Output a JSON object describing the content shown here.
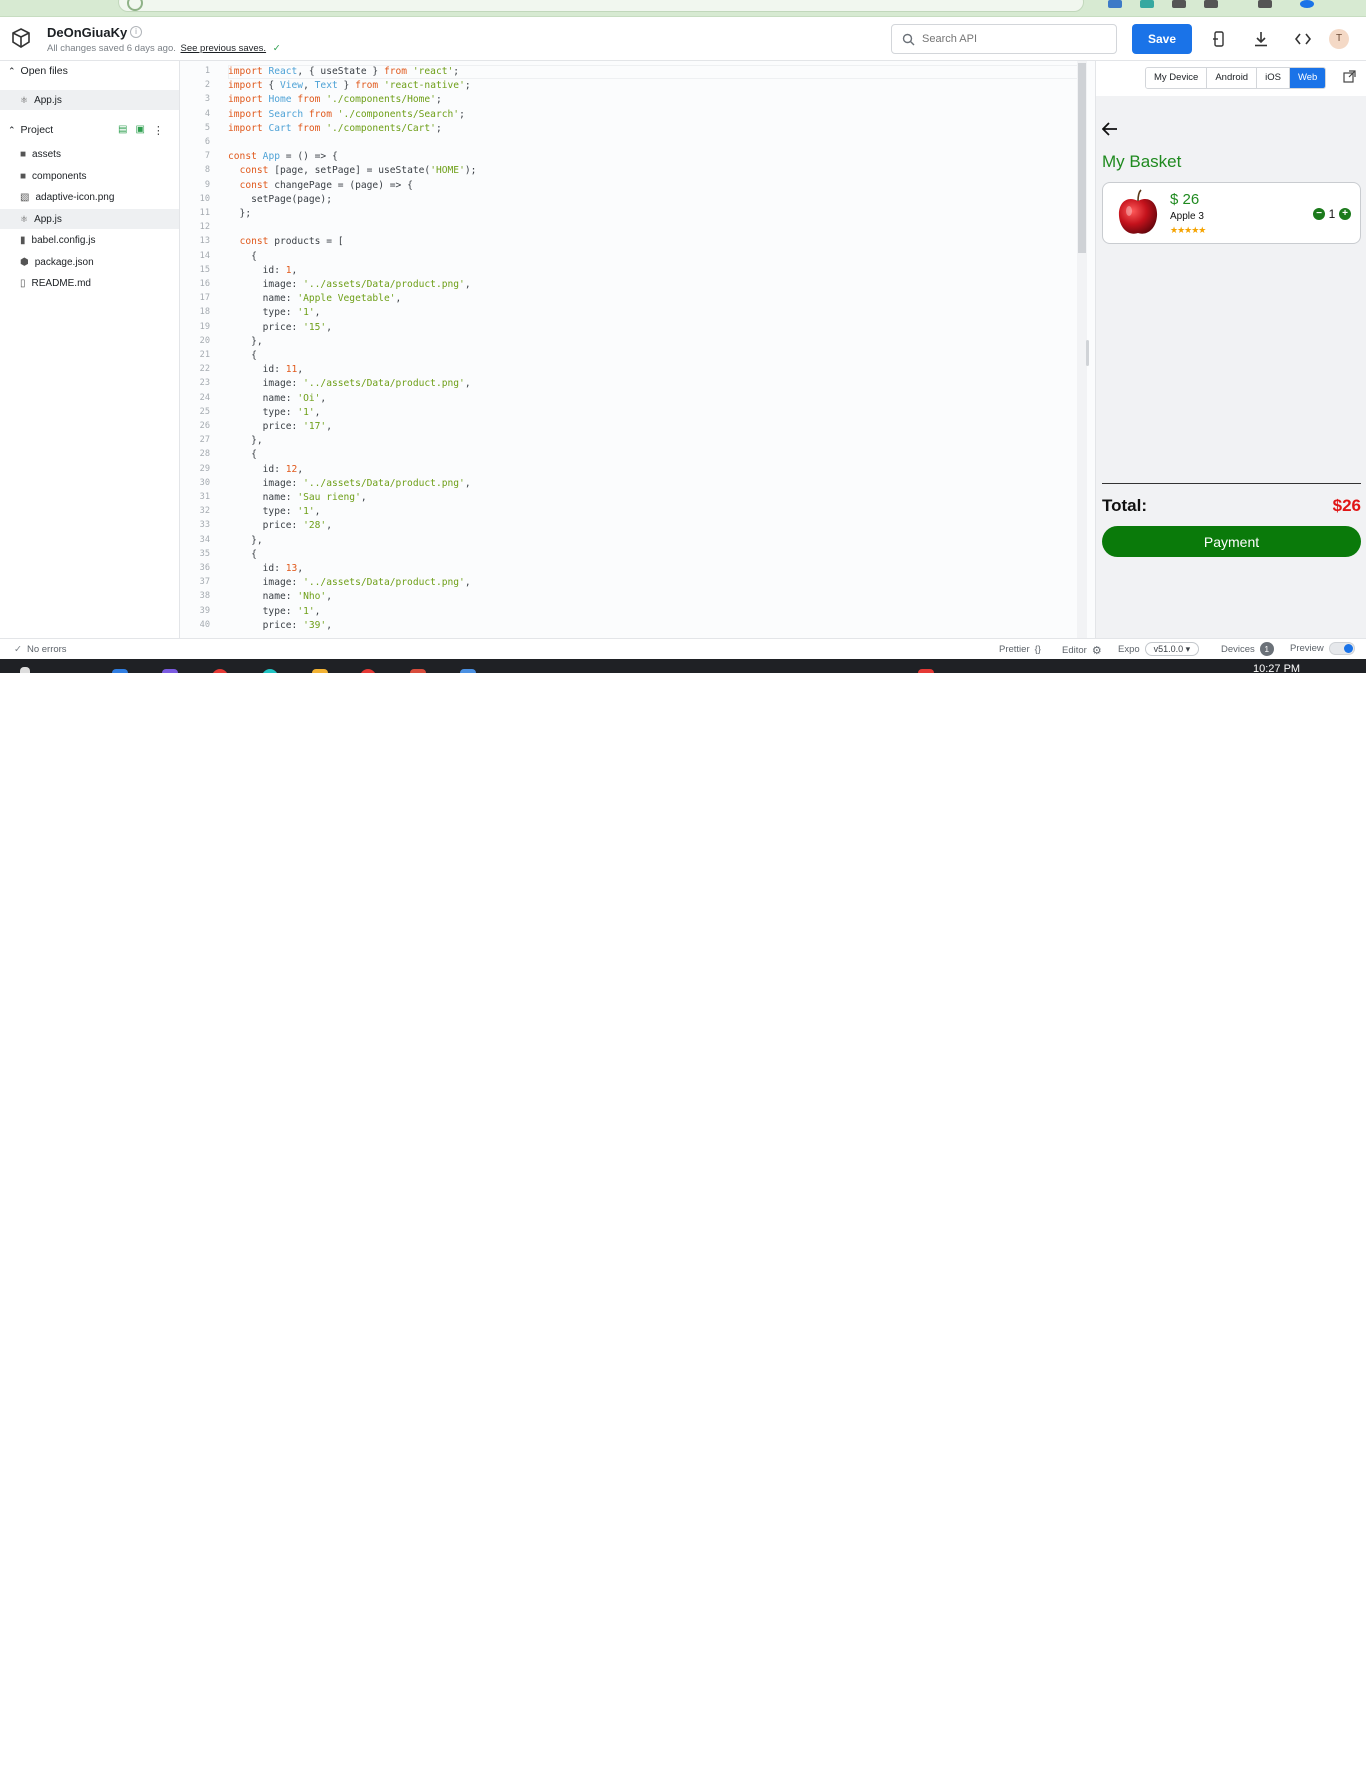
{
  "header": {
    "project_name": "DeOnGiuaKy",
    "saved_status": "All changes saved 6 days ago.",
    "saved_link": "See previous saves.",
    "search_placeholder": "Search API",
    "save_label": "Save",
    "avatar_initial": "T"
  },
  "sidebar": {
    "open_files_label": "Open files",
    "open_files": [
      {
        "name": "App.js",
        "icon": "react-file-icon"
      }
    ],
    "project_label": "Project",
    "project_items": [
      {
        "name": "assets",
        "icon": "folder-icon"
      },
      {
        "name": "components",
        "icon": "folder-icon"
      },
      {
        "name": "adaptive-icon.png",
        "icon": "image-file-icon"
      },
      {
        "name": "App.js",
        "icon": "react-file-icon"
      },
      {
        "name": "babel.config.js",
        "icon": "js-file-icon"
      },
      {
        "name": "package.json",
        "icon": "json-file-icon"
      },
      {
        "name": "README.md",
        "icon": "file-icon"
      }
    ]
  },
  "editor": {
    "lines": [
      [
        [
          "kw",
          "import"
        ],
        [
          "t",
          " "
        ],
        [
          "id",
          "React"
        ],
        [
          "t",
          ", { useState } "
        ],
        [
          "kw",
          "from"
        ],
        [
          "t",
          " "
        ],
        [
          "str",
          "'react'"
        ],
        [
          "t",
          ";"
        ]
      ],
      [
        [
          "kw",
          "import"
        ],
        [
          "t",
          " { "
        ],
        [
          "id",
          "View"
        ],
        [
          "t",
          ", "
        ],
        [
          "id",
          "Text"
        ],
        [
          "t",
          " } "
        ],
        [
          "kw",
          "from"
        ],
        [
          "t",
          " "
        ],
        [
          "str",
          "'react-native'"
        ],
        [
          "t",
          ";"
        ]
      ],
      [
        [
          "kw",
          "import"
        ],
        [
          "t",
          " "
        ],
        [
          "id",
          "Home"
        ],
        [
          "t",
          " "
        ],
        [
          "kw",
          "from"
        ],
        [
          "t",
          " "
        ],
        [
          "str",
          "'./components/Home'"
        ],
        [
          "t",
          ";"
        ]
      ],
      [
        [
          "kw",
          "import"
        ],
        [
          "t",
          " "
        ],
        [
          "id",
          "Search"
        ],
        [
          "t",
          " "
        ],
        [
          "kw",
          "from"
        ],
        [
          "t",
          " "
        ],
        [
          "str",
          "'./components/Search'"
        ],
        [
          "t",
          ";"
        ]
      ],
      [
        [
          "kw",
          "import"
        ],
        [
          "t",
          " "
        ],
        [
          "id",
          "Cart"
        ],
        [
          "t",
          " "
        ],
        [
          "kw",
          "from"
        ],
        [
          "t",
          " "
        ],
        [
          "str",
          "'./components/Cart'"
        ],
        [
          "t",
          ";"
        ]
      ],
      [],
      [
        [
          "kw",
          "const"
        ],
        [
          "t",
          " "
        ],
        [
          "id",
          "App"
        ],
        [
          "t",
          " = () => {"
        ]
      ],
      [
        [
          "t",
          "  "
        ],
        [
          "kw",
          "const"
        ],
        [
          "t",
          " [page, setPage] = useState("
        ],
        [
          "str",
          "'HOME'"
        ],
        [
          "t",
          ");"
        ]
      ],
      [
        [
          "t",
          "  "
        ],
        [
          "kw",
          "const"
        ],
        [
          "t",
          " changePage = (page) => {"
        ]
      ],
      [
        [
          "t",
          "    setPage(page);"
        ]
      ],
      [
        [
          "t",
          "  };"
        ]
      ],
      [],
      [
        [
          "t",
          "  "
        ],
        [
          "kw",
          "const"
        ],
        [
          "t",
          " products = ["
        ]
      ],
      [
        [
          "t",
          "    {"
        ]
      ],
      [
        [
          "t",
          "      id: "
        ],
        [
          "num",
          "1"
        ],
        [
          "t",
          ","
        ]
      ],
      [
        [
          "t",
          "      image: "
        ],
        [
          "str",
          "'../assets/Data/product.png'"
        ],
        [
          "t",
          ","
        ]
      ],
      [
        [
          "t",
          "      name: "
        ],
        [
          "str",
          "'Apple Vegetable'"
        ],
        [
          "t",
          ","
        ]
      ],
      [
        [
          "t",
          "      type: "
        ],
        [
          "str",
          "'1'"
        ],
        [
          "t",
          ","
        ]
      ],
      [
        [
          "t",
          "      price: "
        ],
        [
          "str",
          "'15'"
        ],
        [
          "t",
          ","
        ]
      ],
      [
        [
          "t",
          "    },"
        ]
      ],
      [
        [
          "t",
          "    {"
        ]
      ],
      [
        [
          "t",
          "      id: "
        ],
        [
          "num",
          "11"
        ],
        [
          "t",
          ","
        ]
      ],
      [
        [
          "t",
          "      image: "
        ],
        [
          "str",
          "'../assets/Data/product.png'"
        ],
        [
          "t",
          ","
        ]
      ],
      [
        [
          "t",
          "      name: "
        ],
        [
          "str",
          "'Oi'"
        ],
        [
          "t",
          ","
        ]
      ],
      [
        [
          "t",
          "      type: "
        ],
        [
          "str",
          "'1'"
        ],
        [
          "t",
          ","
        ]
      ],
      [
        [
          "t",
          "      price: "
        ],
        [
          "str",
          "'17'"
        ],
        [
          "t",
          ","
        ]
      ],
      [
        [
          "t",
          "    },"
        ]
      ],
      [
        [
          "t",
          "    {"
        ]
      ],
      [
        [
          "t",
          "      id: "
        ],
        [
          "num",
          "12"
        ],
        [
          "t",
          ","
        ]
      ],
      [
        [
          "t",
          "      image: "
        ],
        [
          "str",
          "'../assets/Data/product.png'"
        ],
        [
          "t",
          ","
        ]
      ],
      [
        [
          "t",
          "      name: "
        ],
        [
          "str",
          "'Sau rieng'"
        ],
        [
          "t",
          ","
        ]
      ],
      [
        [
          "t",
          "      type: "
        ],
        [
          "str",
          "'1'"
        ],
        [
          "t",
          ","
        ]
      ],
      [
        [
          "t",
          "      price: "
        ],
        [
          "str",
          "'28'"
        ],
        [
          "t",
          ","
        ]
      ],
      [
        [
          "t",
          "    },"
        ]
      ],
      [
        [
          "t",
          "    {"
        ]
      ],
      [
        [
          "t",
          "      id: "
        ],
        [
          "num",
          "13"
        ],
        [
          "t",
          ","
        ]
      ],
      [
        [
          "t",
          "      image: "
        ],
        [
          "str",
          "'../assets/Data/product.png'"
        ],
        [
          "t",
          ","
        ]
      ],
      [
        [
          "t",
          "      name: "
        ],
        [
          "str",
          "'Nho'"
        ],
        [
          "t",
          ","
        ]
      ],
      [
        [
          "t",
          "      type: "
        ],
        [
          "str",
          "'1'"
        ],
        [
          "t",
          ","
        ]
      ],
      [
        [
          "t",
          "      price: "
        ],
        [
          "str",
          "'39'"
        ],
        [
          "t",
          ","
        ]
      ]
    ]
  },
  "preview": {
    "device_tabs": [
      "My Device",
      "Android",
      "iOS",
      "Web"
    ],
    "active_tab": "Web",
    "title": "My Basket",
    "item": {
      "price": "$ 26",
      "name": "Apple 3",
      "stars": "★★★★★",
      "quantity": "1",
      "minus": "−",
      "plus": "+"
    },
    "total_label": "Total:",
    "total_value": "$26",
    "payment_label": "Payment"
  },
  "statusbar": {
    "errors": "No errors",
    "prettier": "Prettier",
    "prettier_glyph": "{}",
    "editor": "Editor",
    "expo": "Expo",
    "expo_version": "v51.0.0 ▾",
    "devices": "Devices",
    "devices_count": "1",
    "preview": "Preview"
  },
  "taskbar": {
    "clock": "10:27 PM"
  },
  "colors": {
    "accent": "#1a73e8",
    "green": "#1f8a1f",
    "total_red": "#e01515",
    "payment_green": "#0a7a0a"
  }
}
